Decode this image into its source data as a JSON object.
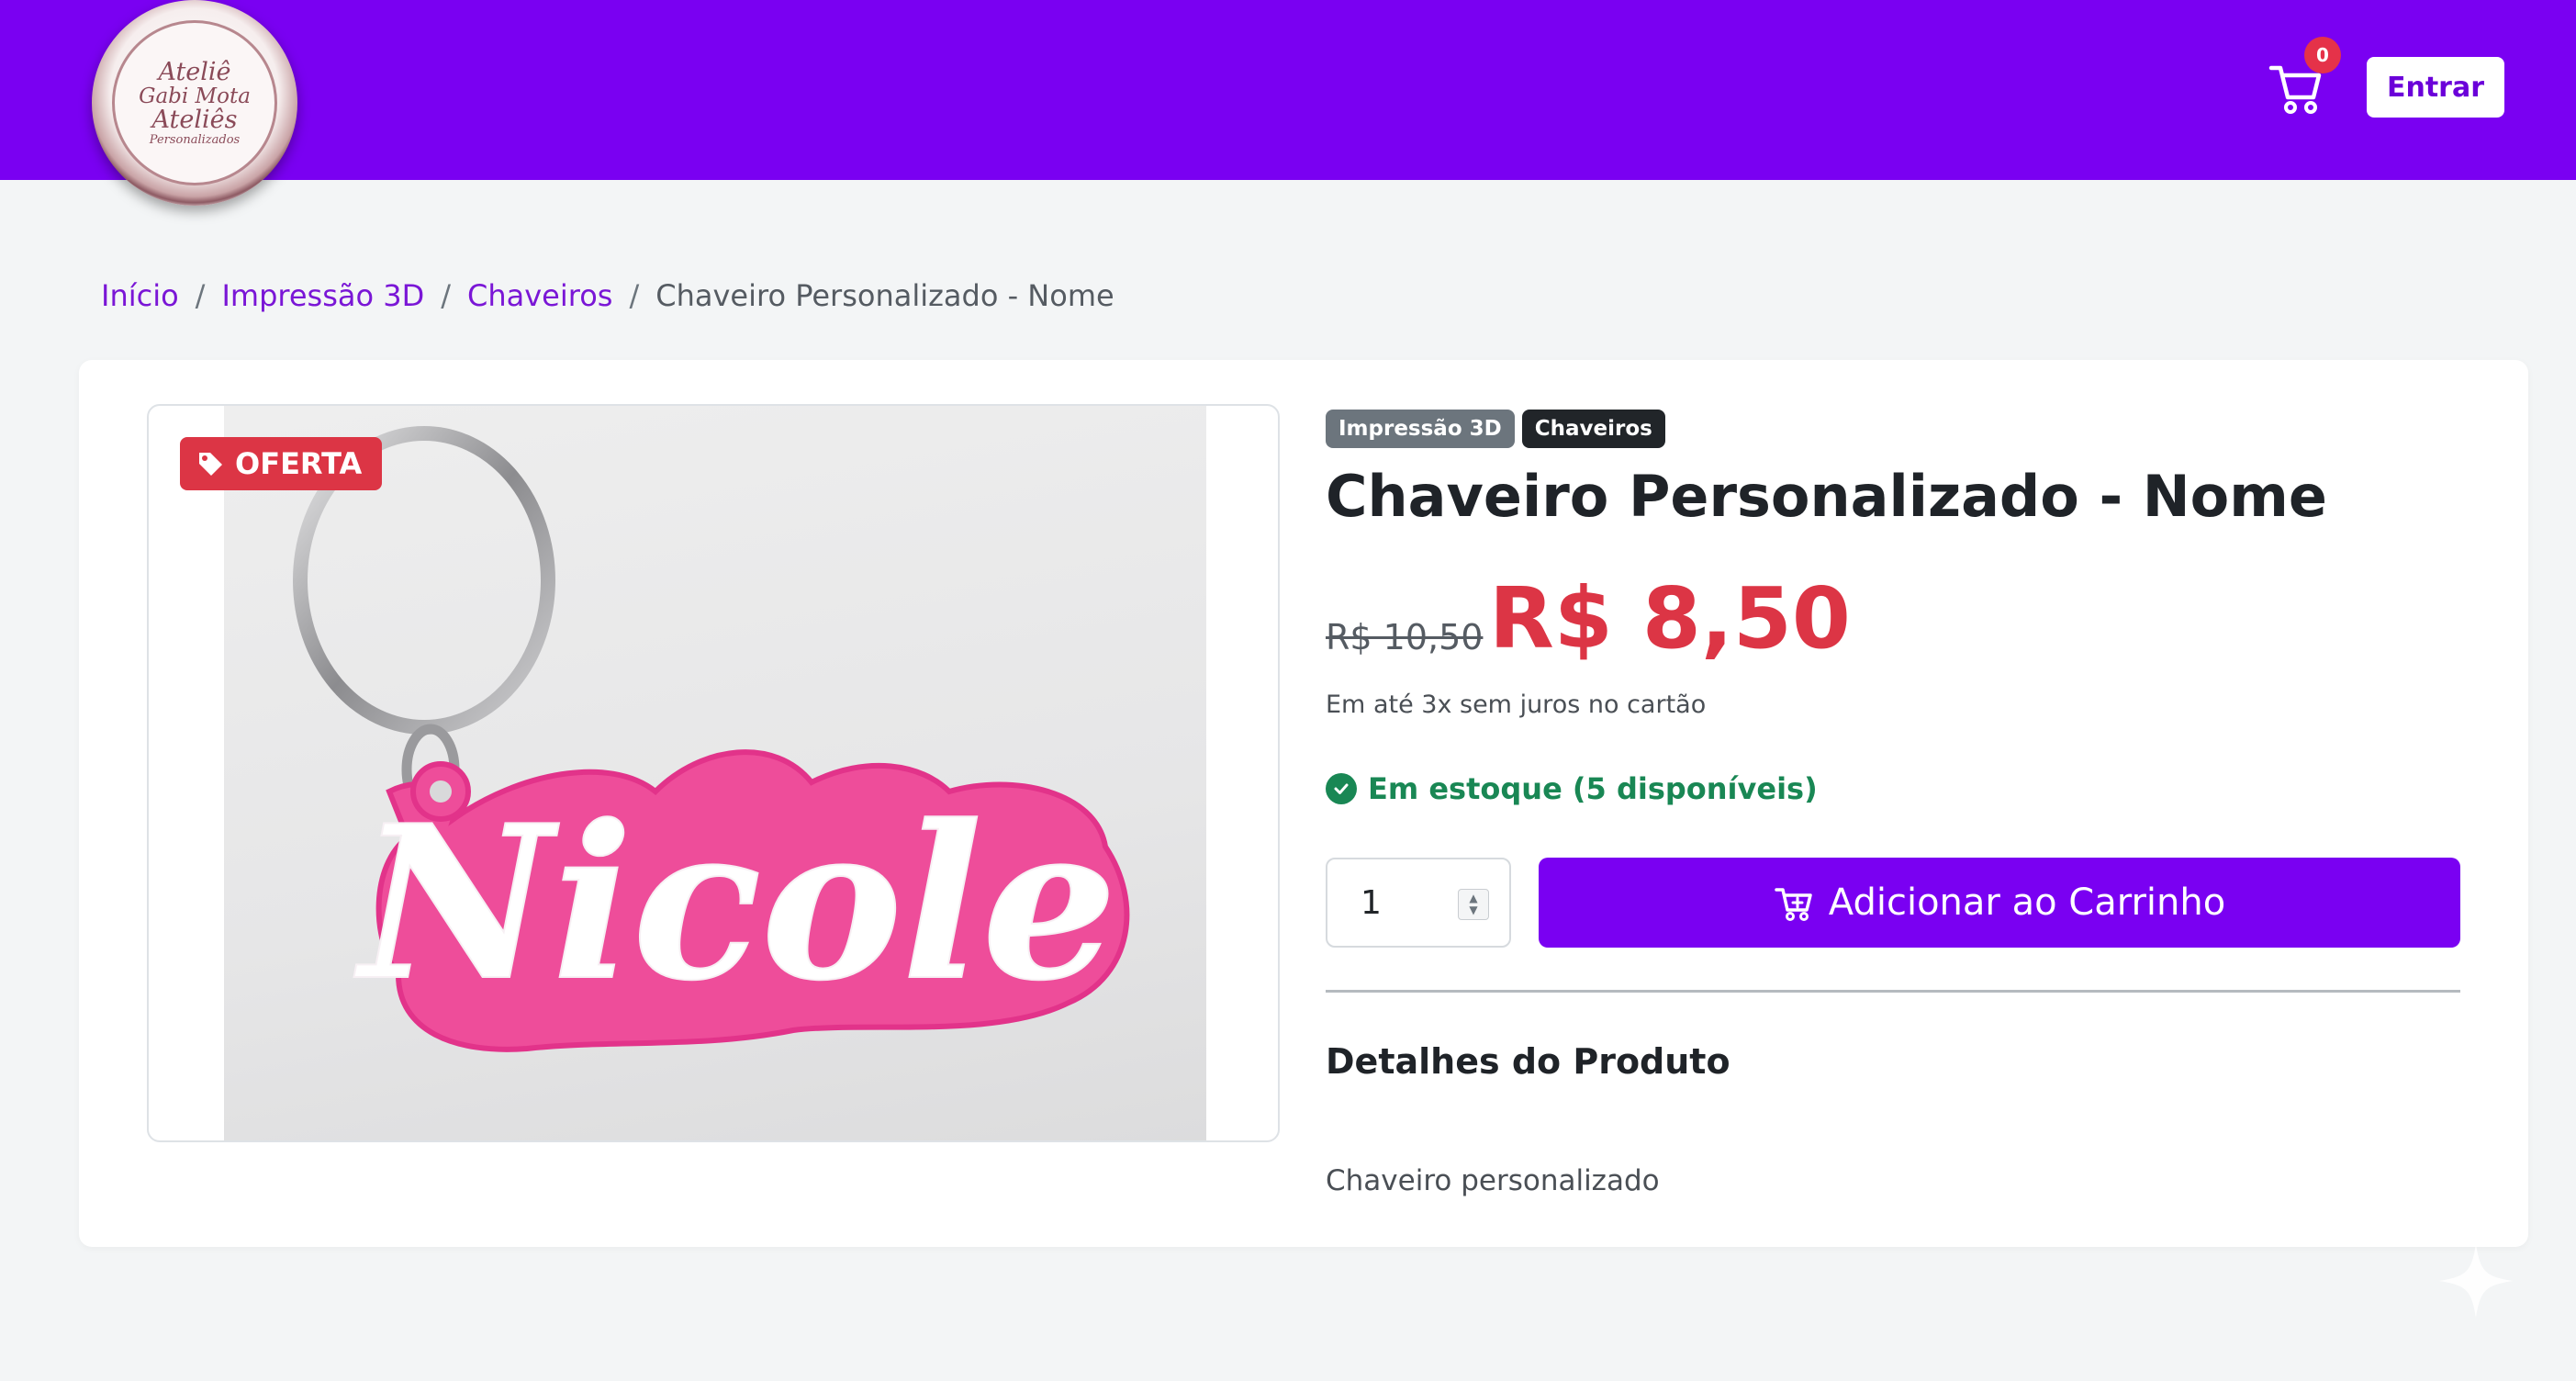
{
  "header": {
    "logo": {
      "line1": "Ateliê",
      "line2": "Gabi Mota",
      "line3": "Ateliês",
      "line4": "Personalizados"
    },
    "cart_count": "0",
    "login_label": "Entrar",
    "brand_color": "#7a00f2"
  },
  "breadcrumb": {
    "items": [
      "Início",
      "Impressão 3D",
      "Chaveiros"
    ],
    "current": "Chaveiro Personalizado - Nome",
    "separator": "/"
  },
  "product": {
    "offer_badge": "OFERTA",
    "image_text": "Nicole",
    "tags": [
      "Impressão 3D",
      "Chaveiros"
    ],
    "title": "Chaveiro Personalizado - Nome",
    "old_price": "R$ 10,50",
    "price": "R$ 8,50",
    "installments": "Em até 3x sem juros no cartão",
    "stock": "Em estoque (5 disponíveis)",
    "quantity": "1",
    "add_to_cart": "Adicionar ao Carrinho",
    "details_title": "Detalhes do Produto",
    "details_text": "Chaveiro personalizado",
    "price_color": "#dc3545",
    "stock_color": "#198754"
  }
}
